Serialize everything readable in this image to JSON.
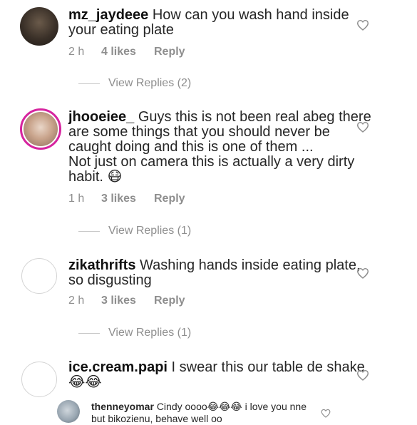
{
  "comments": [
    {
      "username": "mz_jaydeee",
      "text_line1": "How can you wash hand inside",
      "text_line2": "your eating plate",
      "time": "2 h",
      "likes": "4 likes",
      "reply": "Reply",
      "view_replies": "View Replies (2)",
      "avatar_icon": "user-avatar-icon",
      "heart_icon": "heart-outline-icon"
    },
    {
      "username": "jhooeiee_",
      "text_line1": "Guys this is not been real abeg there",
      "text_line2": "are some things that you should never be",
      "text_line3": "caught doing and this is one of them ...",
      "text_line4": "Not just on camera this is actually a very dirty",
      "text_line5": "habit. 😷",
      "time": "1 h",
      "likes": "3 likes",
      "reply": "Reply",
      "view_replies": "View Replies (1)",
      "avatar_icon": "user-avatar-icon",
      "heart_icon": "heart-outline-icon"
    },
    {
      "username": "zikathrifts",
      "text_line1": "Washing hands inside eating plate,",
      "text_line2": "so disgusting",
      "time": "2 h",
      "likes": "3 likes",
      "reply": "Reply",
      "view_replies": "View Replies (1)",
      "avatar_icon": "user-avatar-icon",
      "heart_icon": "heart-outline-icon"
    },
    {
      "username": "ice.cream.papi",
      "text_line1": "I swear this our table de shake",
      "text_line2": "😂😂",
      "avatar_icon": "user-avatar-icon",
      "heart_icon": "heart-outline-icon"
    },
    {
      "username": "thenneyomar",
      "text_line1": "Cindy oooo😂😂😂 i love you nne",
      "text_line2": "but bikozienu, behave well oo",
      "avatar_icon": "user-avatar-icon",
      "heart_icon": "heart-outline-icon"
    }
  ]
}
